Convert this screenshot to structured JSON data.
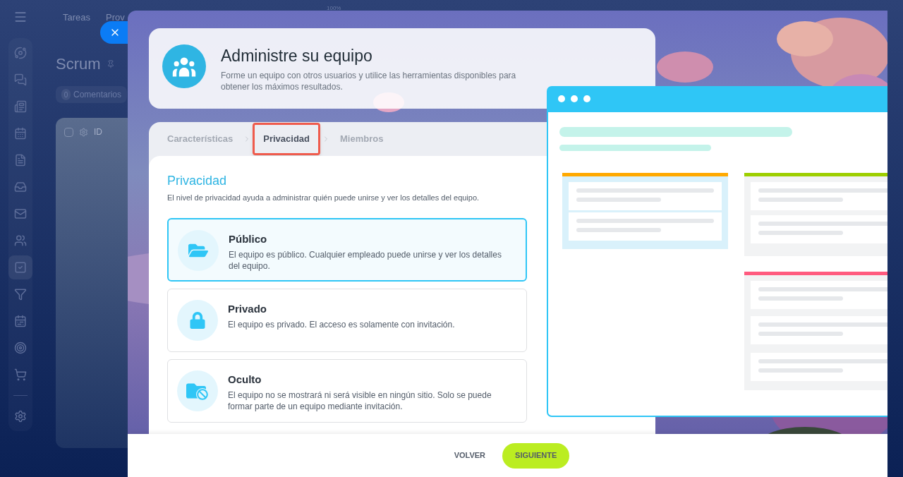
{
  "background_app": {
    "header_tabs": [
      "Tareas",
      "Prov"
    ],
    "zoom": "100%",
    "page_title": "Scrum",
    "comments": {
      "count": "0",
      "label": "Comentarios"
    },
    "table_column": "ID",
    "select_all": {
      "checked": false
    },
    "sidebar": [
      {
        "kind": "flow",
        "selected": false
      },
      {
        "kind": "chat",
        "selected": false
      },
      {
        "kind": "news",
        "selected": false
      },
      {
        "kind": "calendar",
        "selected": false
      },
      {
        "kind": "document",
        "selected": false
      },
      {
        "kind": "tray",
        "selected": false
      },
      {
        "kind": "mail",
        "selected": false
      },
      {
        "kind": "users",
        "selected": false
      },
      {
        "kind": "tasks",
        "selected": true
      },
      {
        "kind": "filter",
        "selected": false
      },
      {
        "kind": "schedule",
        "selected": false
      },
      {
        "kind": "target",
        "selected": false
      },
      {
        "kind": "cart",
        "selected": false
      },
      {
        "kind": "settings",
        "selected": false
      }
    ]
  },
  "modal": {
    "title": "Administre su equipo",
    "description": "Forme un equipo con otros usuarios y utilice las herramientas disponibles para obtener los máximos resultados.",
    "steps": [
      {
        "label": "Características",
        "selected": false
      },
      {
        "label": "Privacidad",
        "selected": true
      },
      {
        "label": "Miembros",
        "selected": false
      }
    ],
    "section_title": "Privacidad",
    "section_description": "El nivel de privacidad ayuda a administrar quién puede unirse y ver los detalles del equipo.",
    "options": [
      {
        "kind": "public",
        "title": "Público",
        "description": "El equipo es público. Cualquier empleado puede unirse y ver los detalles del equipo.",
        "selected": true
      },
      {
        "kind": "private",
        "title": "Privado",
        "description": "El equipo es privado. El acceso es solamente con invitación.",
        "selected": false
      },
      {
        "kind": "hidden",
        "title": "Oculto",
        "description": "El equipo no se mostrará ni será visible en ningún sitio. Solo se puede formar parte de un equipo mediante invitación.",
        "selected": false
      }
    ],
    "buttons": {
      "back": "VOLVER",
      "next": "SIGUIENTE"
    }
  }
}
